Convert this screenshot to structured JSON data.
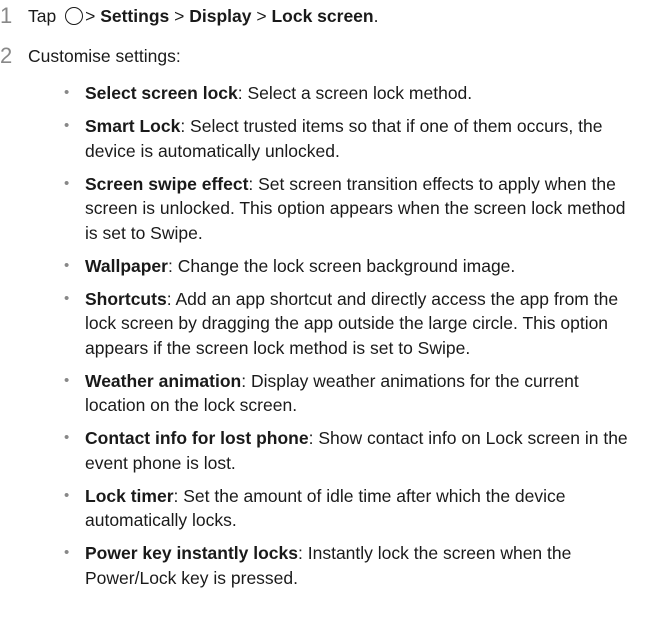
{
  "step1": {
    "number": "1",
    "tap": "Tap",
    "path_sep": ">",
    "settings": "Settings",
    "display": "Display",
    "lock_screen": "Lock screen",
    "end": "."
  },
  "step2": {
    "number": "2",
    "text": "Customise settings:"
  },
  "bullet_glyph": "•",
  "options": [
    {
      "name": "Select screen lock",
      "desc": ": Select a screen lock method."
    },
    {
      "name": "Smart Lock",
      "desc": ": Select trusted items so that if one of them occurs, the device is automatically unlocked."
    },
    {
      "name": "Screen swipe effect",
      "desc": ": Set screen transition effects to apply when the screen is unlocked. This option appears when the screen lock method is set to Swipe."
    },
    {
      "name": "Wallpaper",
      "desc": ": Change the lock screen background image."
    },
    {
      "name": "Shortcuts",
      "desc": ": Add an app shortcut and directly access the app from the lock screen by dragging the app outside the large circle. This option appears if the screen lock method is set to Swipe."
    },
    {
      "name": "Weather animation",
      "desc": ": Display weather animations for the current location on the lock screen."
    },
    {
      "name": "Contact info for lost phone",
      "desc": ": Show contact info on Lock screen in the event phone is lost."
    },
    {
      "name": "Lock timer",
      "desc": ": Set the amount of idle time after which the device automatically locks."
    },
    {
      "name": "Power key instantly locks",
      "desc": ": Instantly lock the screen when the Power/Lock key is pressed."
    }
  ]
}
